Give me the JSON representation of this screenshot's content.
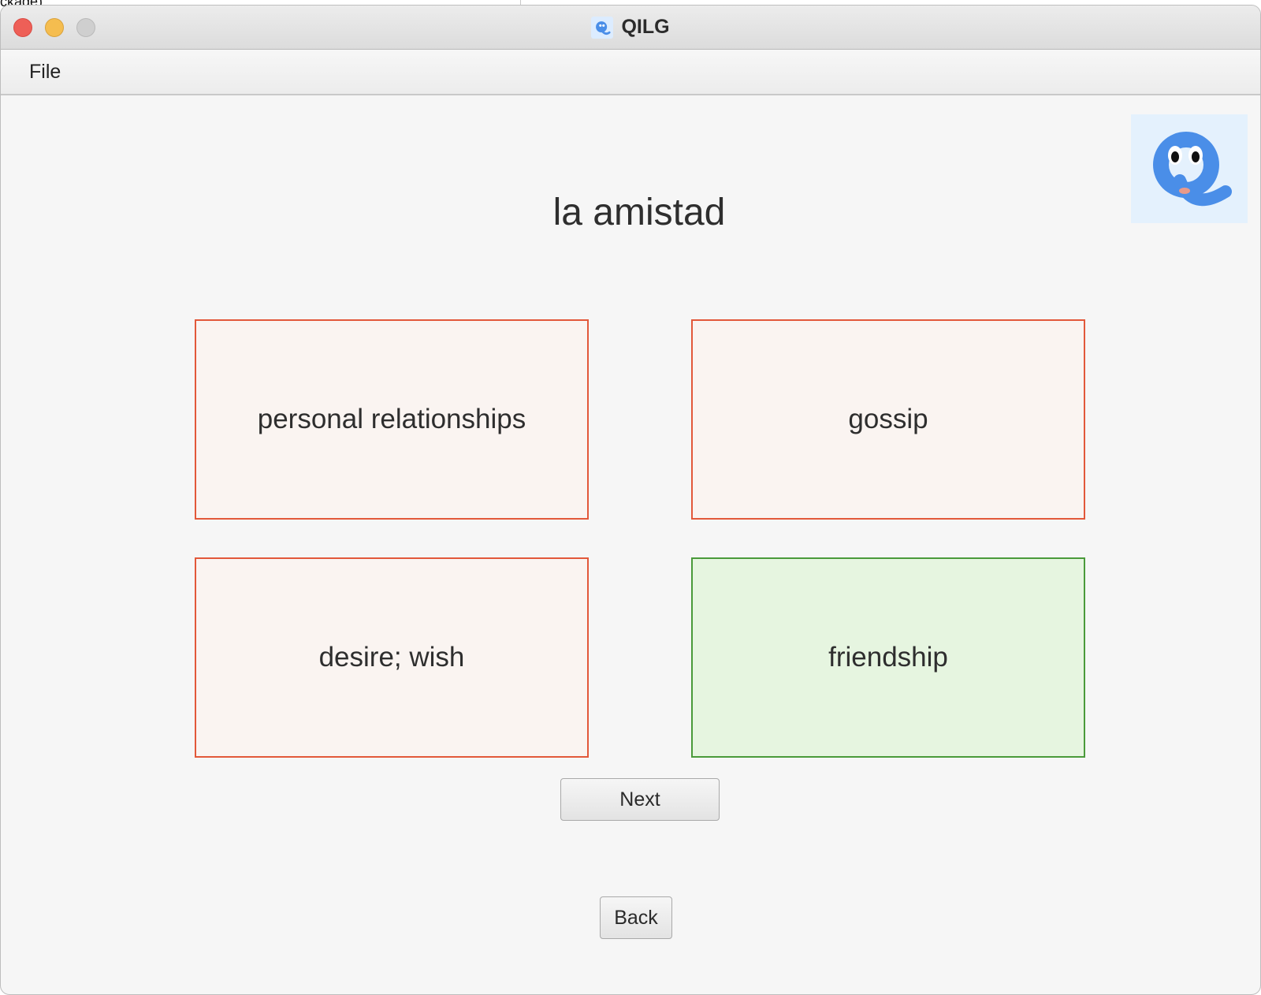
{
  "window": {
    "title": "QILG"
  },
  "backdrop": {
    "left_text": "ckage)"
  },
  "menubar": {
    "file": "File"
  },
  "quiz": {
    "prompt": "la amistad",
    "choices": [
      {
        "label": "personal relationships",
        "state": "wrong"
      },
      {
        "label": "gossip",
        "state": "wrong"
      },
      {
        "label": "desire; wish",
        "state": "wrong"
      },
      {
        "label": "friendship",
        "state": "correct"
      }
    ],
    "next_label": "Next",
    "back_label": "Back"
  },
  "colors": {
    "wrong_border": "#e2583a",
    "wrong_fill": "#faf4f1",
    "correct_border": "#4a9a3a",
    "correct_fill": "#e6f5e0",
    "logo_blue": "#4a8ee8"
  },
  "icons": {
    "app_logo": "qilg-q-ghost-logo"
  }
}
